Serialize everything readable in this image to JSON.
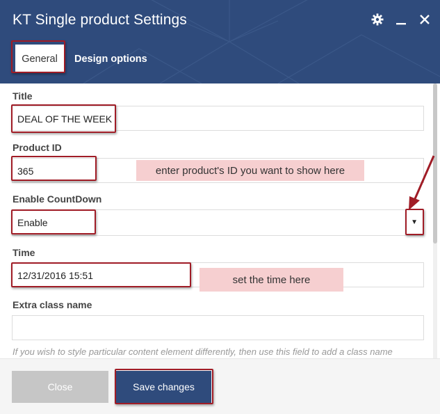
{
  "window": {
    "title": "KT Single product Settings",
    "icons": [
      "gear-icon",
      "minimize-icon",
      "close-icon"
    ]
  },
  "tabs": [
    {
      "label": "General",
      "active": true
    },
    {
      "label": "Design options",
      "active": false
    }
  ],
  "fields": {
    "title": {
      "label": "Title",
      "value": "DEAL OF THE WEEK"
    },
    "product_id": {
      "label": "Product ID",
      "value": "365"
    },
    "countdown": {
      "label": "Enable CountDown",
      "value": "Enable"
    },
    "time": {
      "label": "Time",
      "value": "12/31/2016 15:51"
    },
    "extra_class": {
      "label": "Extra class name",
      "value": "",
      "help": "If you wish to style particular content element differently, then use this field to add a class name"
    }
  },
  "annotations": {
    "product_id_note": "enter product's ID you want to show here",
    "time_note": "set the time here",
    "highlight_color": "#a01c26",
    "note_color": "#f6cfd0"
  },
  "footer": {
    "close_label": "Close",
    "save_label": "Save changes"
  },
  "colors": {
    "header": "#2f4b7c",
    "save_button": "#2f4b7c",
    "close_button": "#c6c6c6"
  }
}
